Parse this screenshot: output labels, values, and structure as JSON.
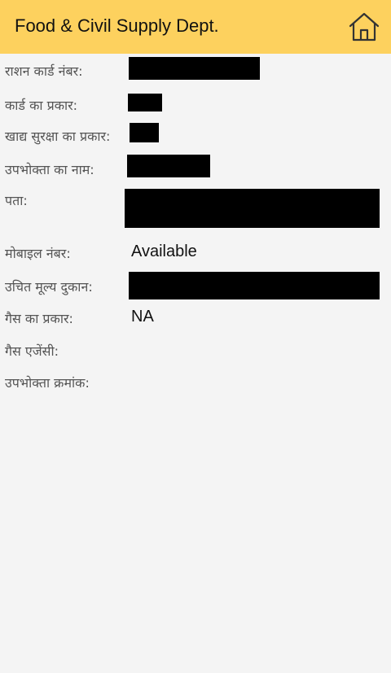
{
  "header": {
    "title": "Food & Civil Supply Dept.",
    "home_icon": "home-icon",
    "background": "#fdd15e"
  },
  "details": {
    "ration_card_number": {
      "label": "राशन कार्ड नंबर:",
      "value": ""
    },
    "card_type": {
      "label": "कार्ड का प्रकार:",
      "value": ""
    },
    "food_security_type": {
      "label": "खाद्य सुरक्षा का प्रकार:",
      "value": ""
    },
    "consumer_name": {
      "label": "उपभोक्ता का नाम:",
      "value": ""
    },
    "address": {
      "label": "पता:",
      "value": ""
    },
    "mobile_number": {
      "label": "मोबाइल नंबर:",
      "value": "Available"
    },
    "fair_price_shop": {
      "label": "उचित मूल्य दुकान:",
      "value": ""
    },
    "gas_type": {
      "label": "गैस का प्रकार:",
      "value": "NA"
    },
    "gas_agency": {
      "label": "गैस एजेंसी:",
      "value": ""
    },
    "consumer_number": {
      "label": "उपभोक्ता क्रमांक:",
      "value": ""
    }
  }
}
